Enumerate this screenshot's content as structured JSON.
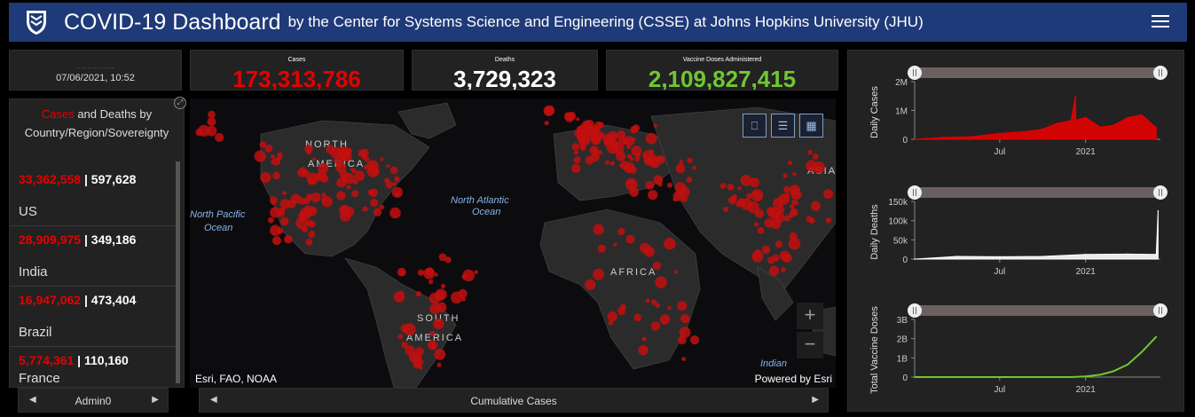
{
  "header": {
    "title": "COVID-19 Dashboard",
    "subtitle": "by the Center for Systems Science and Engineering (CSSE) at Johns Hopkins University (JHU)"
  },
  "last_updated": {
    "date": "07/06/2021, 10:52"
  },
  "stats": {
    "cases_label": "Cases",
    "cases_value": "173,313,786",
    "deaths_label": "Deaths",
    "deaths_value": "3,729,323",
    "vaccine_label": "Vaccine Doses Administered",
    "vaccine_value": "2,109,827,415"
  },
  "colors": {
    "cases": "#e60000",
    "deaths": "#ffffff",
    "vaccine": "#70c732",
    "header_bg": "#1f3a78"
  },
  "list": {
    "heading_red": "Cases",
    "heading_rest": " and Deaths by Country/Region/Sovereignty",
    "rows": [
      {
        "cases": "33,362,558",
        "deaths": "597,628",
        "name": "US"
      },
      {
        "cases": "28,909,975",
        "deaths": "349,186",
        "name": "India"
      },
      {
        "cases": "16,947,062",
        "deaths": "473,404",
        "name": "Brazil"
      },
      {
        "cases": "5,774,361",
        "deaths": "110,160",
        "name": "France"
      }
    ],
    "footer_label": "Admin0"
  },
  "map": {
    "labels": {
      "north_america": "NORTH",
      "north_america_2": "AMERICA",
      "north_atlantic": "North Atlantic",
      "north_atlantic_2": "Ocean",
      "north_pacific": "North Pacific",
      "north_pacific_2": "Ocean",
      "africa": "AFRICA",
      "south_america": "SOUTH",
      "south_america_2": "AMERICA",
      "asia": "ASIA",
      "indian": "Indian"
    },
    "attribution": "Esri, FAO, NOAA",
    "powered": "Powered by Esri",
    "zoom_in": "+",
    "zoom_out": "−",
    "footer_label": "Cumulative Cases"
  },
  "chart_data": [
    {
      "type": "area",
      "title": "",
      "ylabel": "Daily Cases",
      "ytick_labels": [
        "0",
        "1M",
        "2M"
      ],
      "ylim": [
        0,
        2000000
      ],
      "xtick_labels": [
        "Jul",
        "2021"
      ],
      "color": "#e60000",
      "x": [
        "2020-01",
        "2020-03",
        "2020-05",
        "2020-07",
        "2020-09",
        "2020-10",
        "2020-11",
        "2020-12",
        "2020-12-10",
        "2020-12-11",
        "2020-12-20",
        "2021-01",
        "2021-02",
        "2021-03",
        "2021-04",
        "2021-05",
        "2021-06"
      ],
      "values": [
        0,
        60000,
        90000,
        200000,
        280000,
        350000,
        550000,
        650000,
        1500000,
        650000,
        700000,
        750000,
        420000,
        480000,
        750000,
        850000,
        400000
      ]
    },
    {
      "type": "area",
      "title": "",
      "ylabel": "Daily Deaths",
      "ytick_labels": [
        "0",
        "50k",
        "100k",
        "150k"
      ],
      "ylim": [
        0,
        150000
      ],
      "xtick_labels": [
        "Jul",
        "2021"
      ],
      "color": "#ffffff",
      "x": [
        "2020-01",
        "2020-04",
        "2020-07",
        "2020-10",
        "2021-01",
        "2021-04",
        "2021-06-01",
        "2021-06-05"
      ],
      "values": [
        0,
        7000,
        6000,
        7000,
        12000,
        13000,
        12000,
        125000
      ]
    },
    {
      "type": "line",
      "title": "",
      "ylabel": "Total Vaccine Doses",
      "ytick_labels": [
        "0",
        "1B",
        "2B",
        "3B"
      ],
      "ylim": [
        0,
        3000000000
      ],
      "xtick_labels": [
        "Jul",
        "2021"
      ],
      "color": "#70c732",
      "x": [
        "2020-01",
        "2020-12",
        "2021-01",
        "2021-02",
        "2021-03",
        "2021-04",
        "2021-05",
        "2021-06"
      ],
      "values": [
        0,
        0,
        30000000,
        120000000,
        300000000,
        650000000,
        1300000000,
        2100000000
      ]
    }
  ]
}
